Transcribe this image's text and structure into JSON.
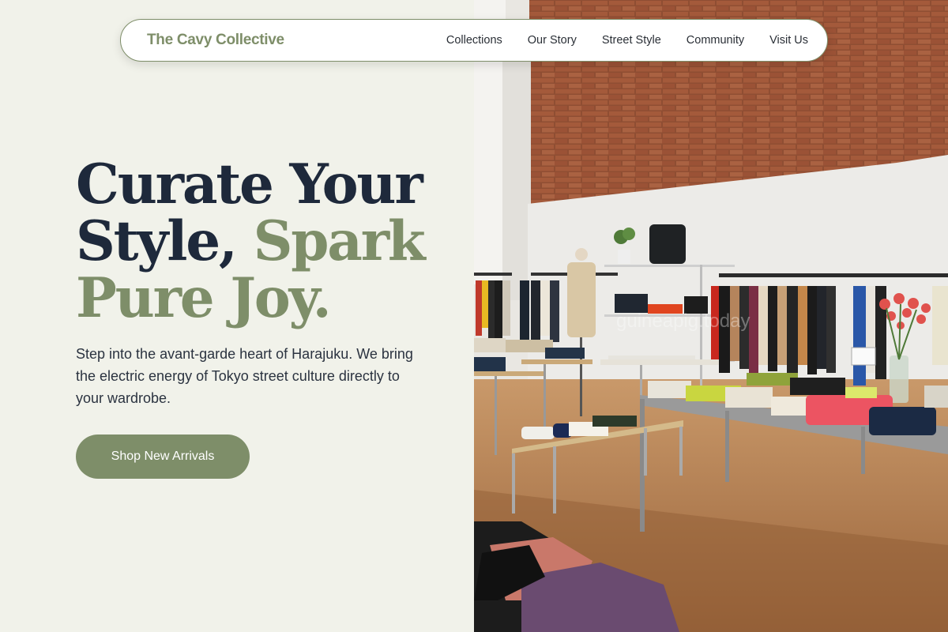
{
  "nav": {
    "brand": "The Cavy Collective",
    "links": [
      "Collections",
      "Our Story",
      "Street Style",
      "Community",
      "Visit Us"
    ]
  },
  "hero": {
    "title_line1": "Curate Your",
    "title_line2_plain": "Style, ",
    "title_line2_accent": "Spark",
    "title_line3_accent": "Pure Joy.",
    "subtitle": "Step into the avant-garde heart of Harajuku. We bring the electric energy of Tokyo street culture directly to your wardrobe.",
    "cta_label": "Shop New Arrivals"
  },
  "photo": {
    "watermark": "guineapig.today"
  },
  "colors": {
    "background": "#f1f2ea",
    "accent": "#7e8e69",
    "heading": "#1e293b",
    "button_text": "#ffffff"
  }
}
